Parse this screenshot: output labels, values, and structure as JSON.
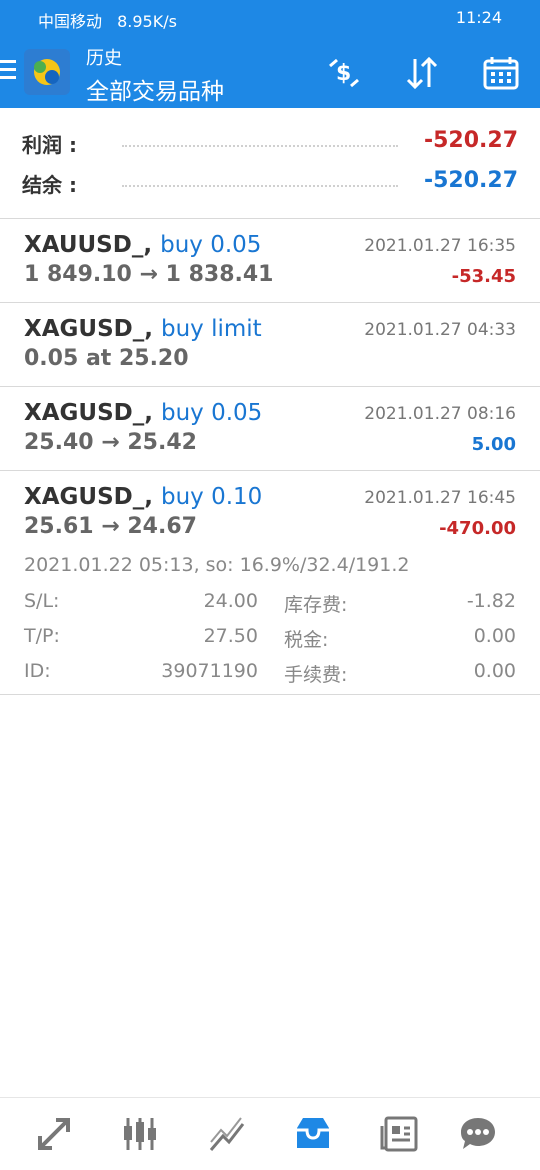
{
  "statusbar": {
    "carrier": "中国移动",
    "speed": "8.95K/s",
    "time": "11:24"
  },
  "header": {
    "title_small": "历史",
    "title_big": "全部交易品种"
  },
  "summary": {
    "profit_label": "利润 :",
    "profit_value": "-520.27",
    "balance_label": "结余 :",
    "balance_value": "-520.27"
  },
  "trades": [
    {
      "symbol": "XAUUSD_,",
      "action": "buy 0.05",
      "prices": "1 849.10 → 1 838.41",
      "time": "2021.01.27 16:35",
      "profit": "-53.45"
    },
    {
      "symbol": "XAGUSD_,",
      "action": "buy limit",
      "prices": "0.05 at 25.20",
      "time": "2021.01.27 04:33",
      "profit": ""
    },
    {
      "symbol": "XAGUSD_,",
      "action": "buy 0.05",
      "prices": "25.40 → 25.42",
      "time": "2021.01.27 08:16",
      "profit": "5.00"
    },
    {
      "symbol": "XAGUSD_,",
      "action": "buy 0.10",
      "prices": "25.61 → 24.67",
      "time": "2021.01.27 16:45",
      "profit": "-470.00",
      "detail": "2021.01.22 05:13, so: 16.9%/32.4/191.2",
      "sl_label": "S/L:",
      "sl": "24.00",
      "swap_label": "库存费:",
      "swap": "-1.82",
      "tp_label": "T/P:",
      "tp": "27.50",
      "tax_label": "税金:",
      "tax": "0.00",
      "id_label": "ID:",
      "id": "39071190",
      "fee_label": "手续费:",
      "fee": "0.00"
    }
  ],
  "colors": {
    "appbar": "#1e88e5",
    "negative": "#c62828",
    "positive": "#1976d2"
  },
  "nav": [
    {
      "icon": "trade-arrows-icon"
    },
    {
      "icon": "candlestick-icon"
    },
    {
      "icon": "chart-line-icon"
    },
    {
      "icon": "history-inbox-icon"
    },
    {
      "icon": "news-icon"
    },
    {
      "icon": "chat-icon"
    }
  ]
}
